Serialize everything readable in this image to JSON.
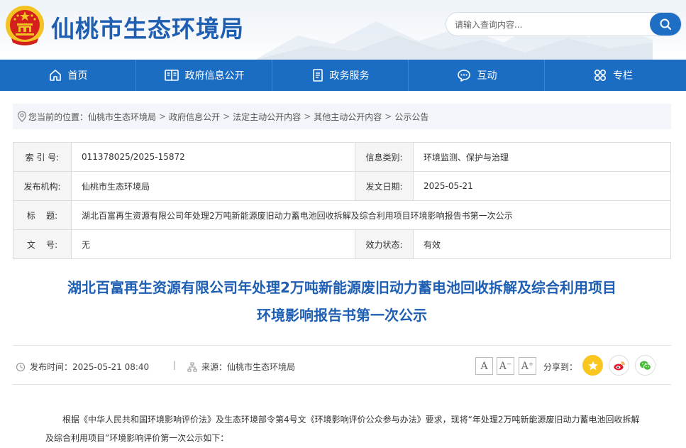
{
  "header": {
    "site_title": "仙桃市生态环境局",
    "search_placeholder": "请输入查询内容..."
  },
  "nav": {
    "items": [
      {
        "label": "首页",
        "icon": "home-icon"
      },
      {
        "label": "政府信息公开",
        "icon": "book-icon"
      },
      {
        "label": "政务服务",
        "icon": "document-icon"
      },
      {
        "label": "互动",
        "icon": "chat-icon"
      },
      {
        "label": "专栏",
        "icon": "grid-icon"
      }
    ]
  },
  "breadcrumb": {
    "prefix": "您当前的位置：",
    "items": [
      "仙桃市生态环境局",
      "政府信息公开",
      "法定主动公开内容",
      "其他主动公开内容",
      "公示公告"
    ],
    "separator": ">"
  },
  "info": {
    "index_label": "索 引 号:",
    "index_value": "011378025/2025-15872",
    "category_label": "信息类别:",
    "category_value": "环境监测、保护与治理",
    "publisher_label": "发布机构:",
    "publisher_value": "仙桃市生态环境局",
    "date_label": "发文日期:",
    "date_value": "2025-05-21",
    "title_label": "标    题:",
    "title_value": "湖北百富再生资源有限公司年处理2万吨新能源废旧动力蓄电池回收拆解及综合利用项目环境影响报告书第一次公示",
    "doc_no_label": "文    号:",
    "doc_no_value": "无",
    "status_label": "效力状态:",
    "status_value": "有效"
  },
  "article": {
    "title_line1": "湖北百富再生资源有限公司年处理2万吨新能源废旧动力蓄电池回收拆解及综合利用项目",
    "title_line2": "环境影响报告书第一次公示",
    "publish_time_label": "发布时间：",
    "publish_time": "2025-05-21 08:40",
    "divider": "|",
    "source_label": "来源：",
    "source": "仙桃市生态环境局",
    "font_buttons": [
      "A",
      "A⁻",
      "A⁺"
    ],
    "share_label": "分享到：",
    "body": "根据《中华人民共和国环境影响评价法》及生态环境部令第4号文《环境影响评价公众参与办法》要求，现将“年处理2万吨新能源废旧动力蓄电池回收拆解及综合利用项目”环境影响评价第一次公示如下："
  },
  "colors": {
    "brand_blue": "#1e5fb3",
    "nav_blue": "#1a6dc3",
    "emblem_red": "#d4201c",
    "emblem_gold": "#f3c323"
  }
}
